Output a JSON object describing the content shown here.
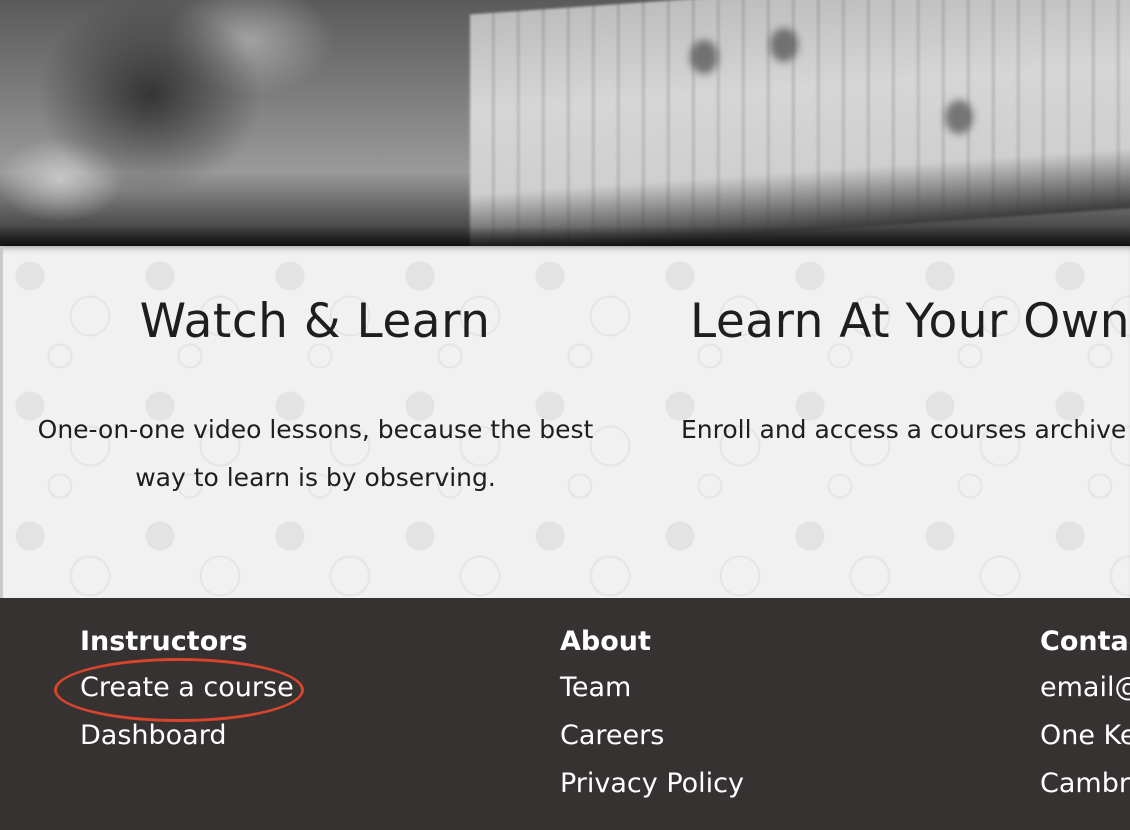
{
  "hero": {
    "image_alt": "Blurred black and white photo of a hand on a guitar fretboard"
  },
  "features": [
    {
      "title": "Watch & Learn",
      "text": "One-on-one video lessons, because the best way to learn is by observing."
    },
    {
      "title": "Learn At Your Own",
      "text": "Enroll and access a courses archive"
    }
  ],
  "footer": {
    "background": "#363232",
    "columns": [
      {
        "heading": "Instructors",
        "links": [
          "Create a course",
          "Dashboard"
        ]
      },
      {
        "heading": "About",
        "links": [
          "Team",
          "Careers",
          "Privacy Policy"
        ]
      },
      {
        "heading": "Contac",
        "links": [
          "email@",
          "One Ke",
          "Cambri"
        ]
      }
    ]
  },
  "annotation": {
    "highlight_color": "#d8452c",
    "highlighted_item": "Create a course"
  }
}
